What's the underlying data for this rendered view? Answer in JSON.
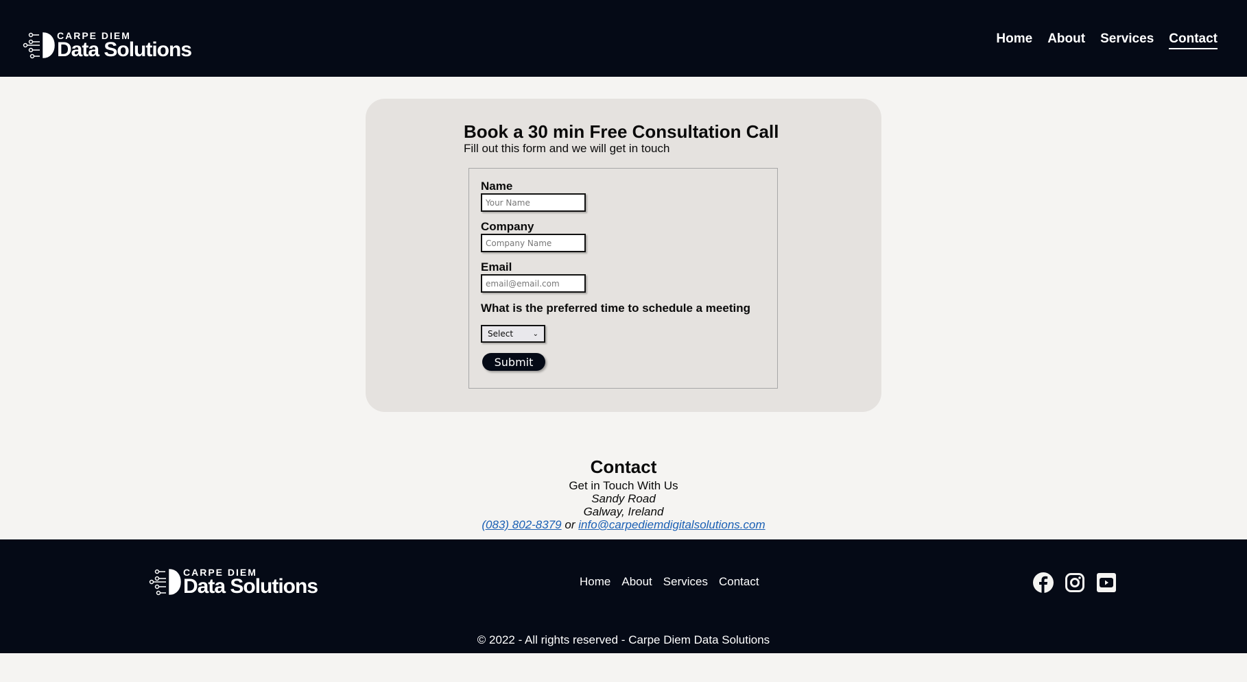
{
  "header": {
    "logo": {
      "line1": "CARPE DIEM",
      "line2": "Data Solutions"
    },
    "nav": [
      "Home",
      "About",
      "Services",
      "Contact"
    ]
  },
  "form": {
    "title": "Book a 30 min Free Consultation Call",
    "subtitle": "Fill out this form and we will get in touch",
    "name_label": "Name",
    "name_placeholder": "Your Name",
    "company_label": "Company",
    "company_placeholder": "Company Name",
    "email_label": "Email",
    "email_placeholder": "email@email.com",
    "time_label": "What is the preferred time to schedule a meeting",
    "time_value": "Select",
    "submit": "Submit"
  },
  "contact": {
    "heading": "Contact",
    "tagline": "Get in Touch With Us",
    "address1": "Sandy Road",
    "address2": "Galway, Ireland",
    "phone": "(083) 802-8379",
    "or": "or",
    "email": "info@carpediemdigitalsolutions.com"
  },
  "footer": {
    "logo": {
      "line1": "CARPE DIEM",
      "line2": "Data Solutions"
    },
    "nav": [
      "Home",
      "About",
      "Services",
      "Contact"
    ],
    "social": [
      "facebook-icon",
      "instagram-icon",
      "youtube-icon"
    ],
    "copyright": "© 2022 - All rights reserved - Carpe Diem Data Solutions"
  }
}
